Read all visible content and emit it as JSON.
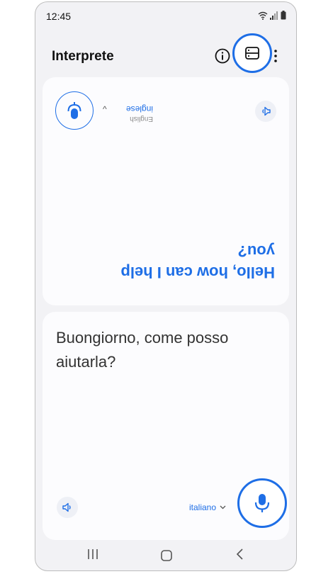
{
  "status_bar": {
    "time": "12:45"
  },
  "app_bar": {
    "title": "Interprete"
  },
  "partner_panel": {
    "language": "inglese",
    "language_native": "English",
    "translated_text": "Hello, how can I help you?"
  },
  "user_panel": {
    "source_text": "Buongiorno, come posso aiutarla?",
    "language": "italiano"
  },
  "colors": {
    "accent": "#1e6ee6",
    "background": "#f2f2f5",
    "card": "#fcfcfe"
  },
  "icons": {
    "info": "info-icon",
    "layout": "layout-toggle-icon",
    "more": "more-vertical-icon",
    "mic": "microphone-icon",
    "speaker": "speaker-icon"
  }
}
